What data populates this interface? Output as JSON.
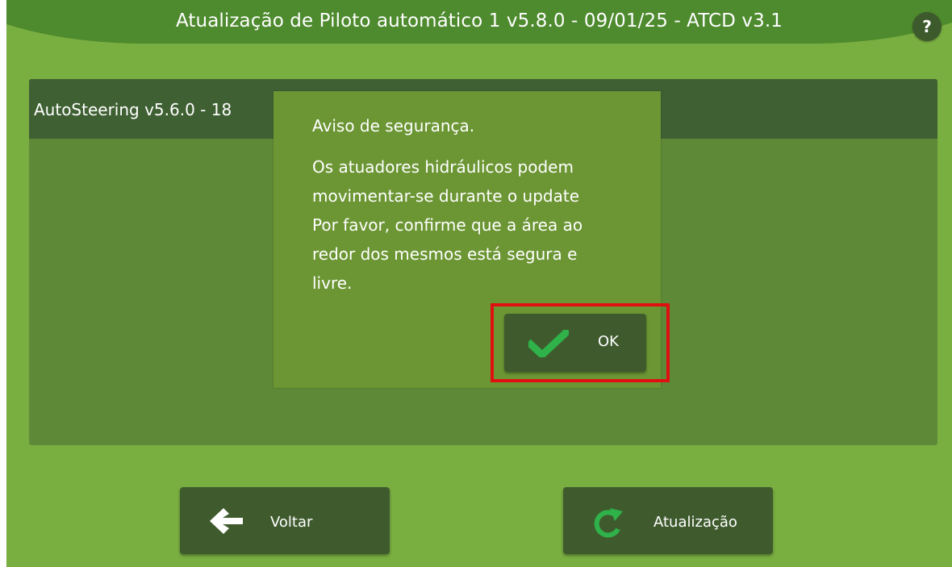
{
  "title_bar": {
    "title": "Atualização de Piloto automático 1 v5.8.0 - 09/01/25 - ATCD v3.1",
    "help_label": "?"
  },
  "list": {
    "items": [
      {
        "label": "AutoSteering v5.6.0 - 18"
      }
    ]
  },
  "dialog": {
    "heading": "Aviso de segurança.",
    "message_lines": [
      "Os atuadores hidráulicos podem",
      "movimentar-se durante o update",
      "Por favor, confirme que a área ao",
      "redor dos mesmos está segura e",
      "livre."
    ],
    "ok_label": "OK",
    "ok_icon": "checkmark-icon"
  },
  "buttons": {
    "back_label": "Voltar",
    "back_icon": "arrow-left-icon",
    "update_label": "Atualização",
    "update_icon": "refresh-icon"
  },
  "colors": {
    "background": "#79ae41",
    "title_bar": "#4e8a2e",
    "panel": "#5e8a37",
    "panel_header": "#3f6032",
    "dialog": "#6c9634",
    "button": "#3f5b2e",
    "accent_green": "#2fb24a",
    "highlight": "#e01010"
  }
}
